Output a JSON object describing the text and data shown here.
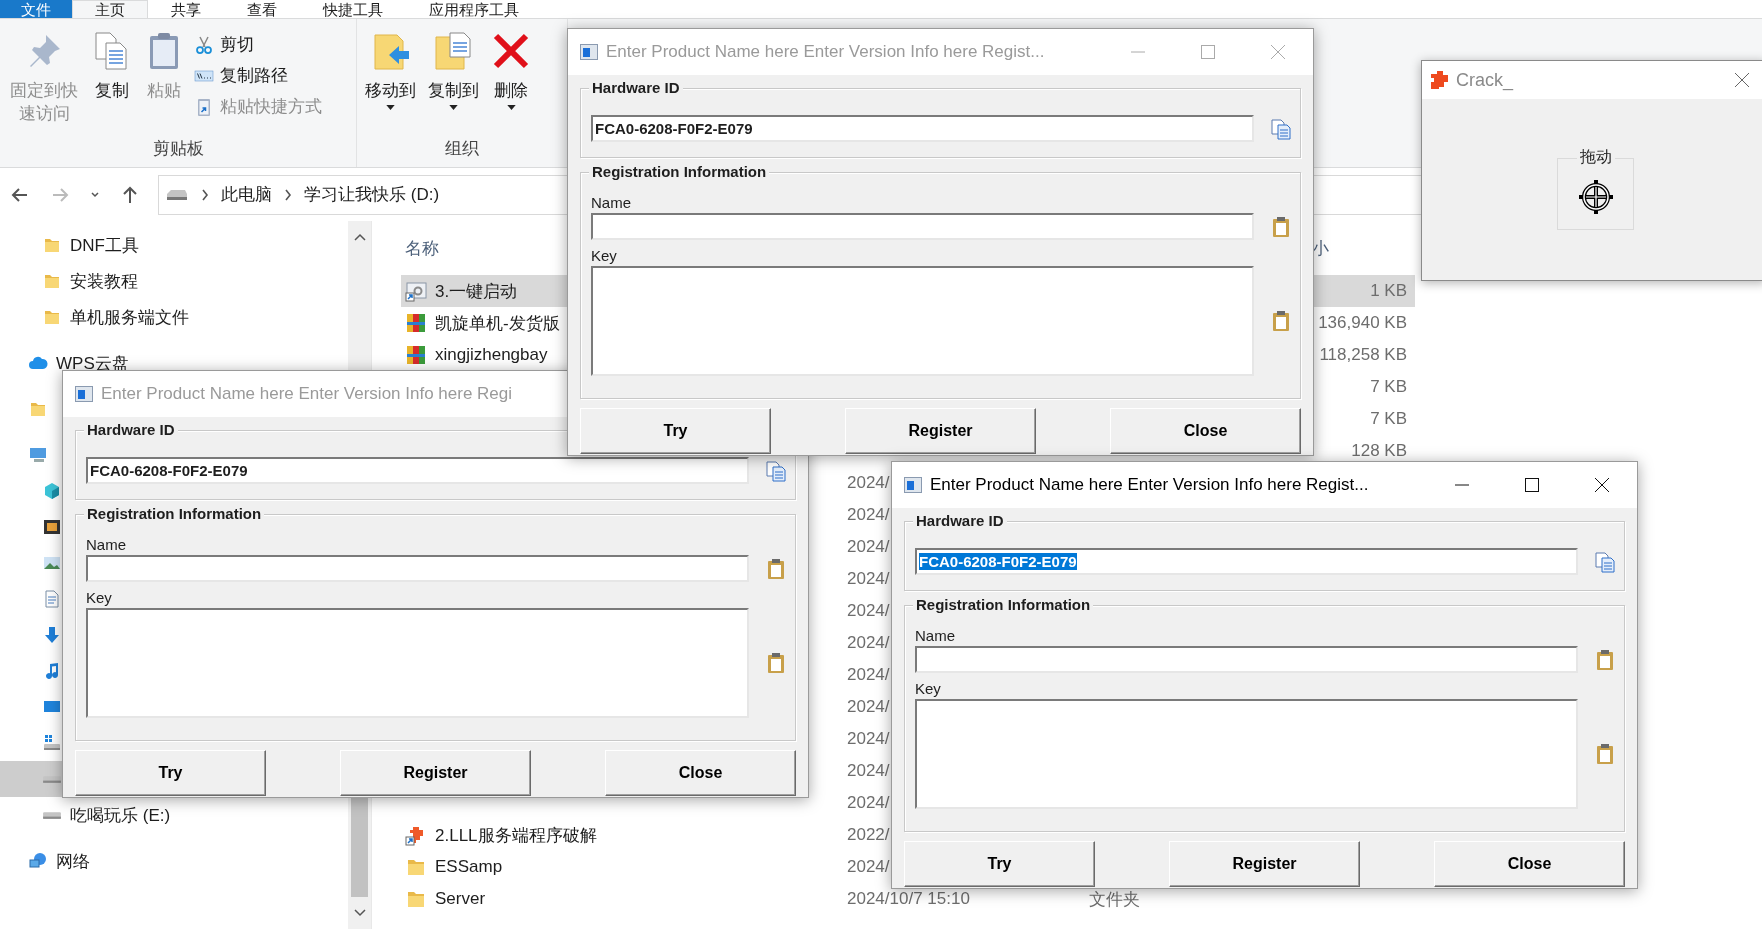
{
  "ribbon_tabs": [
    {
      "kind": "file",
      "label": "文件",
      "selected": false
    },
    {
      "kind": "tab",
      "label": "主页",
      "selected": true
    },
    {
      "kind": "tab",
      "label": "共享",
      "selected": false
    },
    {
      "kind": "tab",
      "label": "查看",
      "selected": false
    },
    {
      "kind": "tab",
      "label": "快捷工具",
      "selected": false
    },
    {
      "kind": "tab",
      "label": "应用程序工具",
      "selected": false
    }
  ],
  "ribbon_groups": [
    {
      "label": "剪贴板",
      "commands": [
        {
          "kind": "pin",
          "label": "固定到快速访问",
          "disabled": true,
          "dropdown": false
        },
        {
          "kind": "copy",
          "label": "复制",
          "disabled": false,
          "dropdown": false
        },
        {
          "kind": "paste",
          "label": "粘贴",
          "disabled": true,
          "dropdown": false
        },
        {
          "kind": "stack",
          "items": [
            {
              "kind": "cut",
              "label": "剪切",
              "disabled": false
            },
            {
              "kind": "copy-path",
              "label": "复制路径",
              "disabled": false
            },
            {
              "kind": "paste-shortcut",
              "label": "粘贴快捷方式",
              "disabled": true
            }
          ]
        }
      ]
    },
    {
      "label": "组织",
      "commands": [
        {
          "kind": "move-to",
          "label": "移动到",
          "disabled": false,
          "dropdown": true
        },
        {
          "kind": "copy-to",
          "label": "复制到",
          "disabled": false,
          "dropdown": true
        },
        {
          "kind": "delete",
          "label": "删除",
          "disabled": false,
          "dropdown": true
        }
      ]
    }
  ],
  "address_bar": {
    "segments": [
      "此电脑",
      "学习让我快乐 (D:)"
    ]
  },
  "navigation": {
    "quick_access": [
      {
        "label": "DNF工具",
        "selected": false
      },
      {
        "label": "安装教程",
        "selected": false
      },
      {
        "label": "单机服务端文件",
        "selected": false
      }
    ],
    "tree": [
      {
        "kind": "cloud",
        "label": "WPS云盘",
        "selected": false
      },
      {
        "kind": "folder",
        "selected": false
      },
      {
        "kind": "computer",
        "selected": false,
        "children": [
          {
            "kind": "objects",
            "selected": false
          },
          {
            "kind": "video",
            "selected": false
          },
          {
            "kind": "pictures",
            "selected": false
          },
          {
            "kind": "documents",
            "selected": false
          },
          {
            "kind": "downloads",
            "selected": false
          },
          {
            "kind": "music",
            "selected": false
          },
          {
            "kind": "desktop",
            "selected": false
          },
          {
            "kind": "windows-drive",
            "selected": false
          },
          {
            "kind": "drive",
            "selected": true
          },
          {
            "kind": "drive",
            "label": "吃喝玩乐 (E:)",
            "selected": false
          }
        ]
      },
      {
        "kind": "network",
        "label": "网络",
        "selected": false
      }
    ]
  },
  "file_list": {
    "name_header": "名称",
    "size_header": "小",
    "rows": [
      {
        "kind": "shortcut",
        "name": "3.一键启动",
        "size": "1 KB",
        "selected": true
      },
      {
        "kind": "archive",
        "name": "凯旋单机-发货版",
        "size": "136,940 KB",
        "selected": false
      },
      {
        "kind": "archive",
        "name": "xingjizhengbay",
        "size": "118,258 KB",
        "selected": false
      },
      {
        "size": "7 KB",
        "selected": false
      },
      {
        "size": "7 KB",
        "selected": false
      },
      {
        "size": "128 KB",
        "selected": false
      },
      {
        "date": "2024/",
        "selected": false
      },
      {
        "date": "2024/",
        "selected": false
      },
      {
        "date": "2024/",
        "selected": false
      },
      {
        "date": "2024/",
        "selected": false
      },
      {
        "date": "2024/",
        "selected": false
      },
      {
        "date": "2024/",
        "selected": false
      },
      {
        "date": "2024/",
        "selected": false
      },
      {
        "date": "2024/",
        "selected": false
      },
      {
        "date": "2024/",
        "selected": false
      },
      {
        "date": "2024/",
        "selected": false
      },
      {
        "date": "2024/",
        "selected": false
      },
      {
        "kind": "app-shortcut",
        "name": "2.LLL服务端程序破解",
        "date": "2022/",
        "selected": false
      },
      {
        "kind": "folder",
        "name": "ESSamp",
        "date": "2024/",
        "selected": false
      },
      {
        "kind": "folder",
        "name": "Server",
        "date": "2024/10/7 15:10",
        "type": "文件夹",
        "selected": false
      }
    ]
  },
  "dialogs": [
    {
      "title": "Enter Product Name here Enter Version Info here Regist...",
      "active": false,
      "hardware_id_label": "Hardware ID",
      "hardware_id": "FCA0-6208-F0F2-E079",
      "hardware_id_selected": false,
      "registration_label": "Registration Information",
      "name_label": "Name",
      "key_label": "Key",
      "buttons": [
        "Try",
        "Register",
        "Close"
      ]
    },
    {
      "title": "Enter Product Name here Enter Version Info here Regi",
      "active": false,
      "hardware_id_label": "Hardware ID",
      "hardware_id": "FCA0-6208-F0F2-E079",
      "hardware_id_selected": false,
      "registration_label": "Registration Information",
      "name_label": "Name",
      "key_label": "Key",
      "buttons": [
        "Try",
        "Register",
        "Close"
      ]
    },
    {
      "title": "Enter Product Name here Enter Version Info here Regist...",
      "active": true,
      "hardware_id_label": "Hardware ID",
      "hardware_id": "FCA0-6208-F0F2-E079",
      "hardware_id_selected": true,
      "registration_label": "Registration Information",
      "name_label": "Name",
      "key_label": "Key",
      "buttons": [
        "Try",
        "Register",
        "Close"
      ]
    }
  ],
  "crack_window": {
    "title": "Crack_",
    "group_label": "拖动"
  }
}
